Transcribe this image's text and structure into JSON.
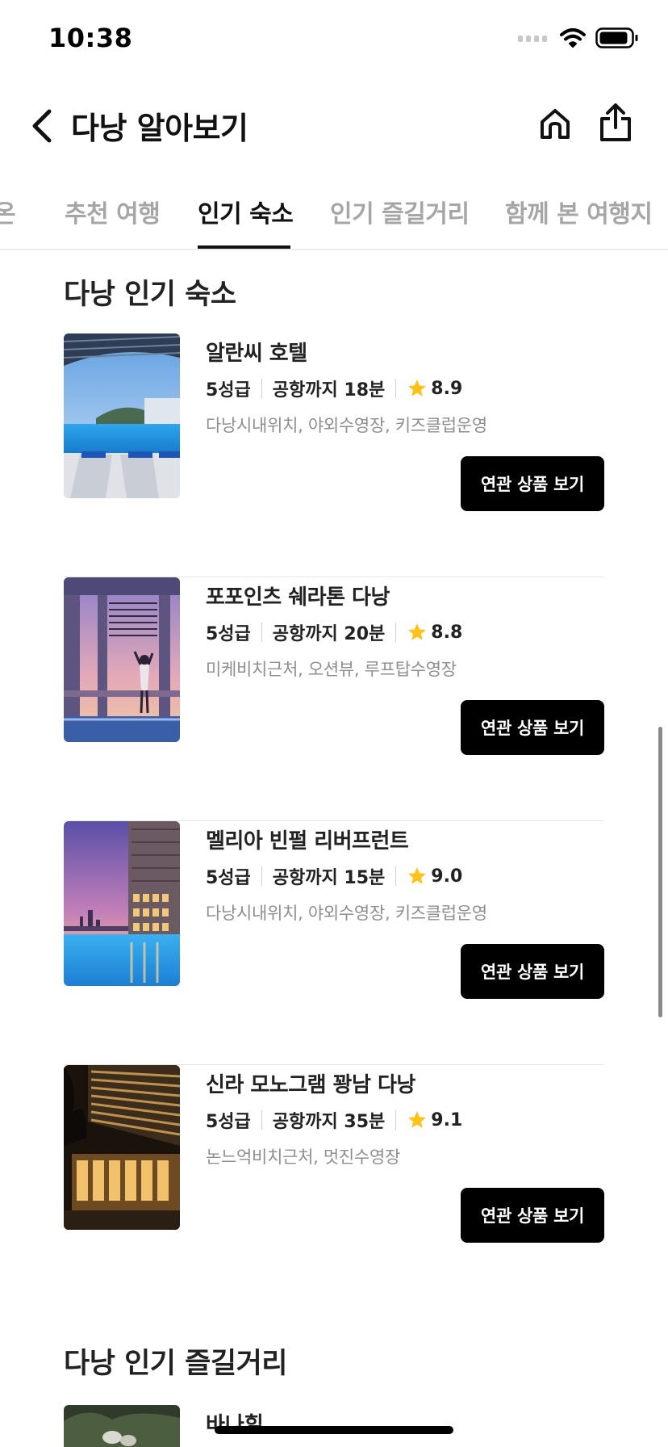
{
  "status_bar": {
    "time": "10:38"
  },
  "nav": {
    "title": "다낭 알아보기"
  },
  "tabs": [
    {
      "label": "온"
    },
    {
      "label": "추천 여행"
    },
    {
      "label": "인기 숙소"
    },
    {
      "label": "인기 즐길거리"
    },
    {
      "label": "함께 본 여행지"
    }
  ],
  "active_tab": "인기 숙소",
  "popular_stays": {
    "title": "다낭 인기 숙소",
    "hotels": [
      {
        "name": "알란씨 호텔",
        "grade": "5성급",
        "airport": "공항까지 18분",
        "rating": "8.9",
        "tags": "다낭시내위치, 야외수영장, 키즈클럽운영",
        "button": "연관 상품 보기",
        "image": "pool-deck-photo"
      },
      {
        "name": "포포인츠 쉐라톤 다낭",
        "grade": "5성급",
        "airport": "공항까지 20분",
        "rating": "8.8",
        "tags": "미케비치근처, 오션뷰, 루프탑수영장",
        "button": "연관 상품 보기",
        "image": "sunset-pool-photo"
      },
      {
        "name": "멜리아 빈펄 리버프런트",
        "grade": "5성급",
        "airport": "공항까지 15분",
        "rating": "9.0",
        "tags": "다낭시내위치, 야외수영장, 키즈클럽운영",
        "button": "연관 상품 보기",
        "image": "river-pool-photo"
      },
      {
        "name": "신라 모노그램 꽝남 다낭",
        "grade": "5성급",
        "airport": "공항까지 35분",
        "rating": "9.1",
        "tags": "논느억비치근처, 멋진수영장",
        "button": "연관 상품 보기",
        "image": "night-hotel-photo"
      }
    ]
  },
  "popular_activities": {
    "title": "다낭 인기 즐길거리",
    "items": [
      {
        "name": "바나힐",
        "image": "ba-na-hills-photo"
      }
    ]
  },
  "colors": {
    "accent_button": "#000000",
    "star": "#FFC21A",
    "tab_inactive": "#A6A6A6",
    "text_primary": "#222222",
    "text_secondary": "#8E8E8E"
  },
  "icons": [
    "back-chevron-icon",
    "home-icon",
    "share-icon",
    "star-icon",
    "wifi-icon",
    "battery-icon",
    "cellular-signal-icon"
  ]
}
